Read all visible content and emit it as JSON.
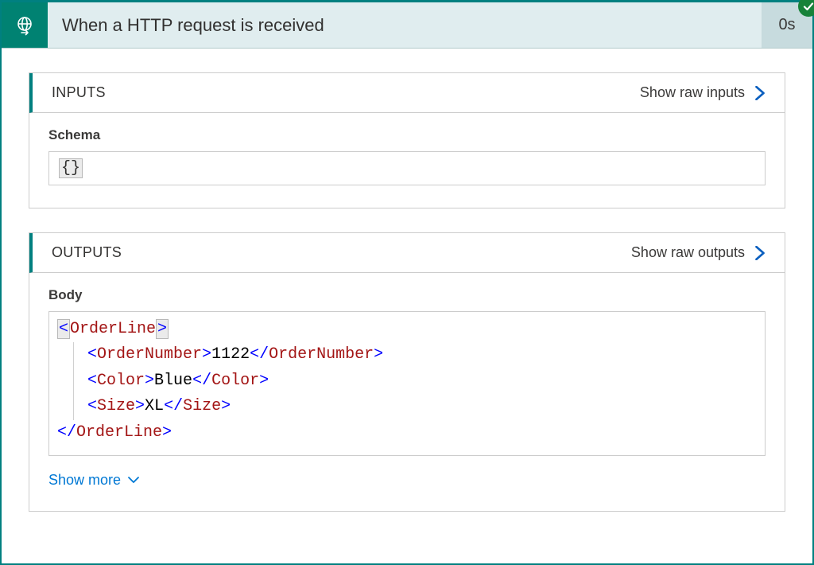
{
  "header": {
    "title": "When a HTTP request is received",
    "duration": "0s",
    "status": "success"
  },
  "inputs": {
    "panel_title": "INPUTS",
    "raw_link": "Show raw inputs",
    "schema_label": "Schema",
    "schema_value": "{}"
  },
  "outputs": {
    "panel_title": "OUTPUTS",
    "raw_link": "Show raw outputs",
    "body_label": "Body",
    "xml": {
      "root_tag": "OrderLine",
      "children": [
        {
          "tag": "OrderNumber",
          "value": "1122"
        },
        {
          "tag": "Color",
          "value": "Blue"
        },
        {
          "tag": "Size",
          "value": "XL"
        }
      ]
    },
    "show_more": "Show more"
  }
}
